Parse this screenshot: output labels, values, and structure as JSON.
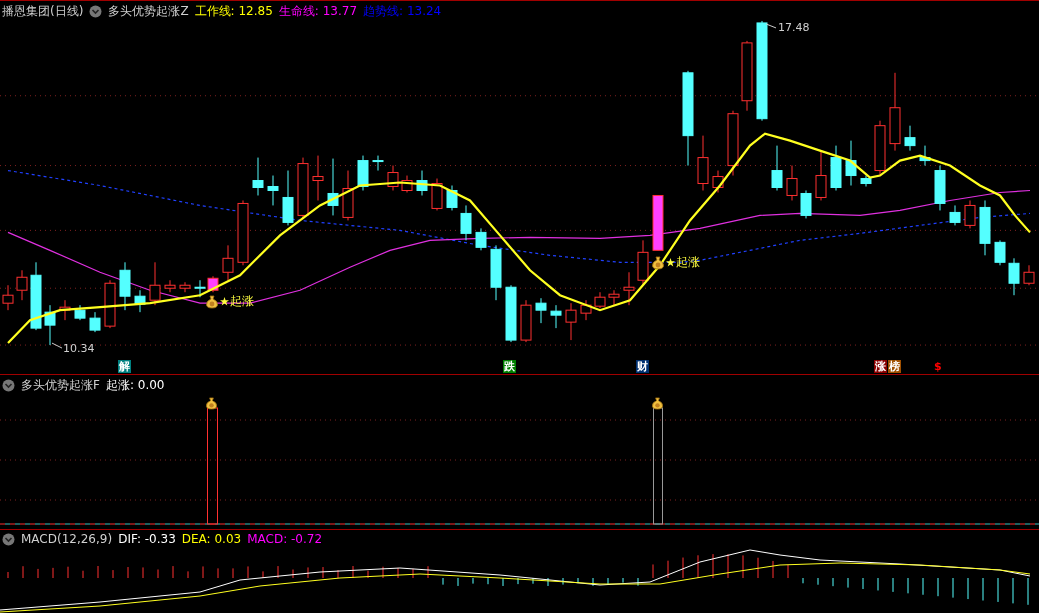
{
  "main_panel": {
    "title": "播恩集团(日线)",
    "indicator": "多头优势起涨Z",
    "readings": [
      {
        "label": "工作线: 12.85",
        "color": "#ffff00"
      },
      {
        "label": "生命线: 13.77",
        "color": "#ff00ff"
      },
      {
        "label": "趋势线: 13.24",
        "color": "#0000ff"
      }
    ],
    "high_label": "17.48",
    "low_label": "10.34",
    "signals": [
      {
        "label": "起涨"
      },
      {
        "label": "起涨"
      }
    ],
    "markers": [
      {
        "label": "解",
        "color": "#008080"
      },
      {
        "label": "跌",
        "color": "#008000"
      },
      {
        "label": "财",
        "color": "#003070"
      },
      {
        "label": "涨",
        "color": "#8b0000"
      },
      {
        "label": "榜",
        "color": "#a05000"
      },
      {
        "label": "$",
        "color": "#ff0000"
      }
    ]
  },
  "signal_panel": {
    "indicator": "多头优势起涨F",
    "reading": "起涨: 0.00"
  },
  "macd_panel": {
    "indicator": "MACD(12,26,9)",
    "readings": [
      {
        "label": "DIF: -0.33",
        "color": "#ffffff"
      },
      {
        "label": "DEA: 0.03",
        "color": "#ffff00"
      },
      {
        "label": "MACD: -0.72",
        "color": "#ff00ff"
      }
    ]
  }
}
